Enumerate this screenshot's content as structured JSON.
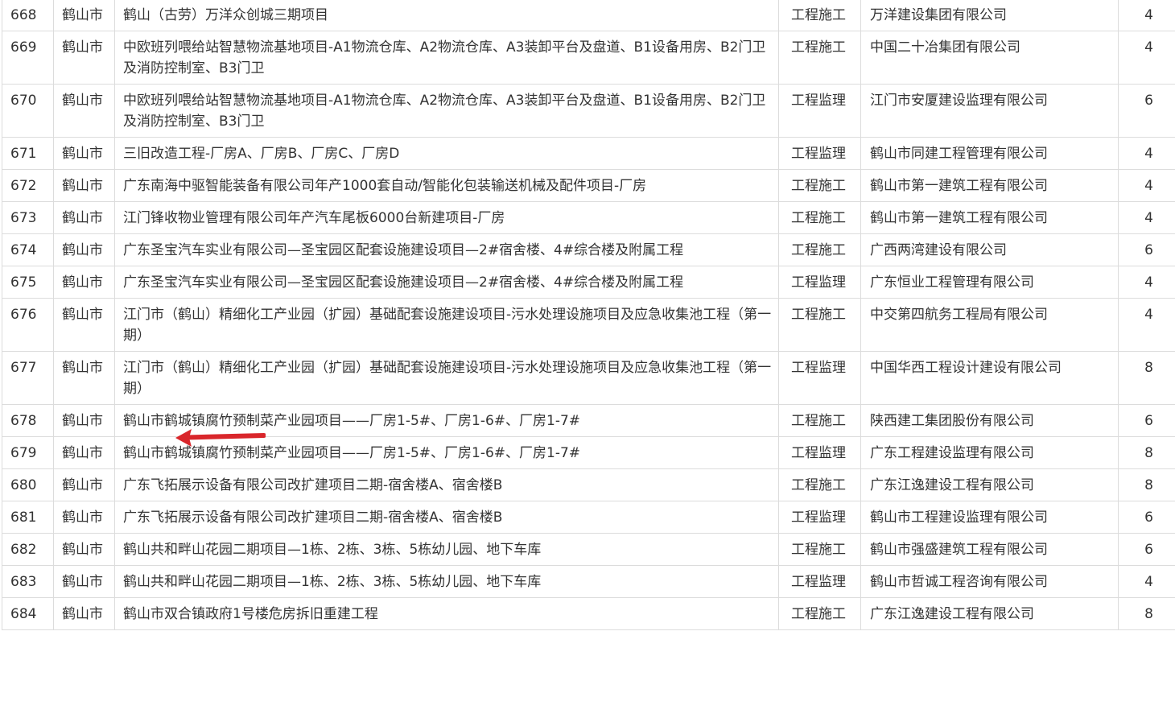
{
  "table": {
    "rows": [
      {
        "no": "668",
        "city": "鹤山市",
        "project": "鹤山（古劳）万洋众创城三期项目",
        "type": "工程施工",
        "company": "万洋建设集团有限公司",
        "score": "4"
      },
      {
        "no": "669",
        "city": "鹤山市",
        "project": "中欧班列喂给站智慧物流基地项目-A1物流仓库、A2物流仓库、A3装卸平台及盘道、B1设备用房、B2门卫及消防控制室、B3门卫",
        "type": "工程施工",
        "company": "中国二十冶集团有限公司",
        "score": "4"
      },
      {
        "no": "670",
        "city": "鹤山市",
        "project": "中欧班列喂给站智慧物流基地项目-A1物流仓库、A2物流仓库、A3装卸平台及盘道、B1设备用房、B2门卫及消防控制室、B3门卫",
        "type": "工程监理",
        "company": "江门市安厦建设监理有限公司",
        "score": "6"
      },
      {
        "no": "671",
        "city": "鹤山市",
        "project": "三旧改造工程-厂房A、厂房B、厂房C、厂房D",
        "type": "工程监理",
        "company": "鹤山市同建工程管理有限公司",
        "score": "4"
      },
      {
        "no": "672",
        "city": "鹤山市",
        "project": "广东南海中驱智能装备有限公司年产1000套自动/智能化包装输送机械及配件项目-厂房",
        "type": "工程施工",
        "company": "鹤山市第一建筑工程有限公司",
        "score": "4"
      },
      {
        "no": "673",
        "city": "鹤山市",
        "project": "江门锋收物业管理有限公司年产汽车尾板6000台新建项目-厂房",
        "type": "工程施工",
        "company": "鹤山市第一建筑工程有限公司",
        "score": "4"
      },
      {
        "no": "674",
        "city": "鹤山市",
        "project": "广东圣宝汽车实业有限公司—圣宝园区配套设施建设项目—2#宿舍楼、4#综合楼及附属工程",
        "type": "工程施工",
        "company": "广西两湾建设有限公司",
        "score": "6"
      },
      {
        "no": "675",
        "city": "鹤山市",
        "project": "广东圣宝汽车实业有限公司—圣宝园区配套设施建设项目—2#宿舍楼、4#综合楼及附属工程",
        "type": "工程监理",
        "company": "广东恒业工程管理有限公司",
        "score": "4"
      },
      {
        "no": "676",
        "city": "鹤山市",
        "project": "江门市（鹤山）精细化工产业园（扩园）基础配套设施建设项目-污水处理设施项目及应急收集池工程（第一期）",
        "type": "工程施工",
        "company": "中交第四航务工程局有限公司",
        "score": "4"
      },
      {
        "no": "677",
        "city": "鹤山市",
        "project": "江门市（鹤山）精细化工产业园（扩园）基础配套设施建设项目-污水处理设施项目及应急收集池工程（第一期）",
        "type": "工程监理",
        "company": "中国华西工程设计建设有限公司",
        "score": "8"
      },
      {
        "no": "678",
        "city": "鹤山市",
        "project": "鹤山市鹤城镇腐竹预制菜产业园项目——厂房1-5#、厂房1-6#、厂房1-7#",
        "type": "工程施工",
        "company": "陕西建工集团股份有限公司",
        "score": "6"
      },
      {
        "no": "679",
        "city": "鹤山市",
        "project": "鹤山市鹤城镇腐竹预制菜产业园项目——厂房1-5#、厂房1-6#、厂房1-7#",
        "type": "工程监理",
        "company": "广东工程建设监理有限公司",
        "score": "8"
      },
      {
        "no": "680",
        "city": "鹤山市",
        "project": "广东飞拓展示设备有限公司改扩建项目二期-宿舍楼A、宿舍楼B",
        "type": "工程施工",
        "company": "广东江逸建设工程有限公司",
        "score": "8"
      },
      {
        "no": "681",
        "city": "鹤山市",
        "project": "广东飞拓展示设备有限公司改扩建项目二期-宿舍楼A、宿舍楼B",
        "type": "工程监理",
        "company": "鹤山市工程建设监理有限公司",
        "score": "6"
      },
      {
        "no": "682",
        "city": "鹤山市",
        "project": "鹤山共和畔山花园二期项目—1栋、2栋、3栋、5栋幼儿园、地下车库",
        "type": "工程施工",
        "company": "鹤山市强盛建筑工程有限公司",
        "score": "6"
      },
      {
        "no": "683",
        "city": "鹤山市",
        "project": "鹤山共和畔山花园二期项目—1栋、2栋、3栋、5栋幼儿园、地下车库",
        "type": "工程监理",
        "company": "鹤山市哲诚工程咨询有限公司",
        "score": "4"
      },
      {
        "no": "684",
        "city": "鹤山市",
        "project": "鹤山市双合镇政府1号楼危房拆旧重建工程",
        "type": "工程施工",
        "company": "广东江逸建设工程有限公司",
        "score": "8"
      }
    ]
  },
  "annotation": {
    "arrow_icon": "red-left-arrow-icon",
    "arrow_color": "#d9262b"
  }
}
